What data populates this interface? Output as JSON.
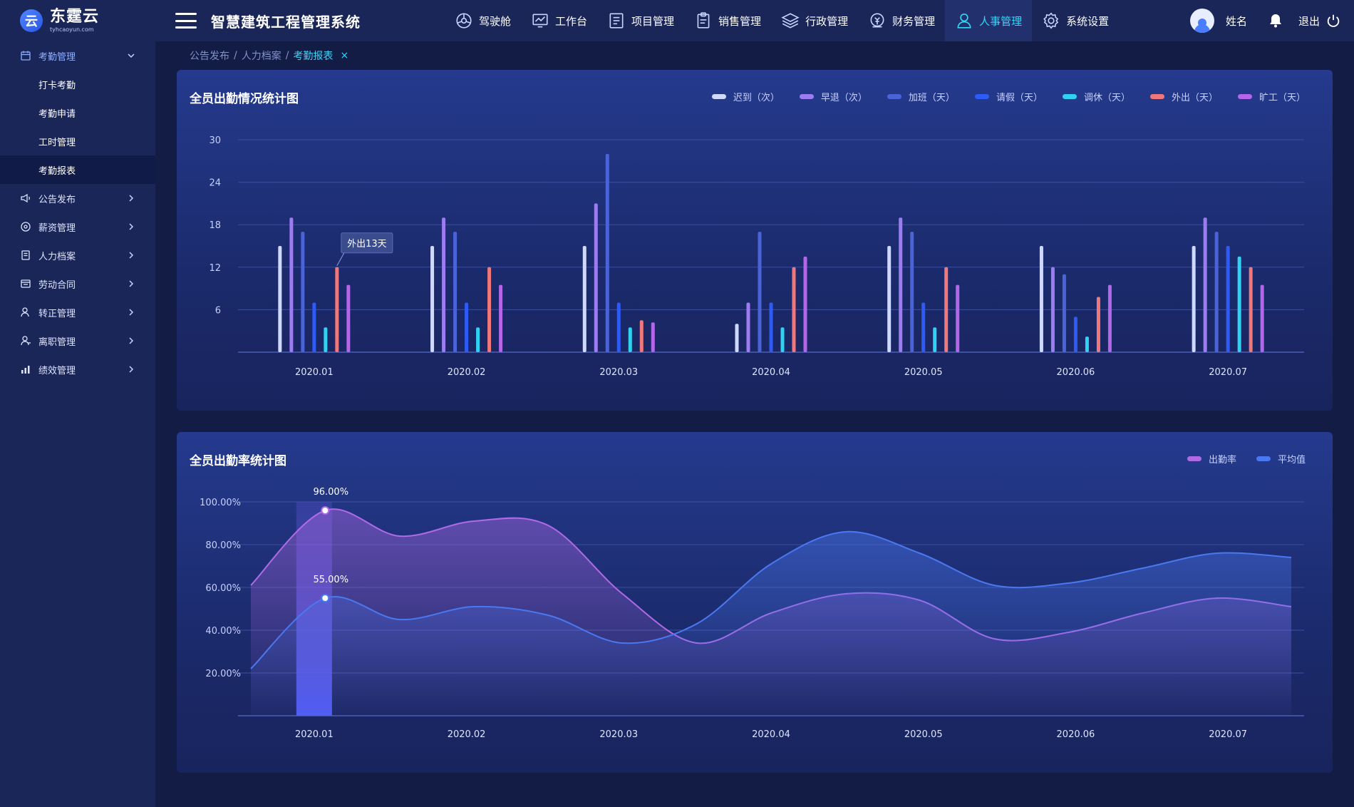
{
  "app": {
    "brand_name": "东霆云",
    "brand_sub": "tyhcaoyun.com",
    "title": "智慧建筑工程管理系统"
  },
  "topnav": [
    {
      "label": "驾驶舱",
      "icon": "dashboard-icon"
    },
    {
      "label": "工作台",
      "icon": "monitor-chart-icon"
    },
    {
      "label": "项目管理",
      "icon": "project-list-icon"
    },
    {
      "label": "销售管理",
      "icon": "clipboard-icon"
    },
    {
      "label": "行政管理",
      "icon": "layers-icon"
    },
    {
      "label": "财务管理",
      "icon": "money-icon"
    },
    {
      "label": "人事管理",
      "icon": "person-icon",
      "active": true
    },
    {
      "label": "系统设置",
      "icon": "gear-icon"
    }
  ],
  "user": {
    "name": "姓名",
    "logout_label": "退出"
  },
  "sidebar": {
    "group": {
      "label": "考勤管理",
      "icon": "calendar-icon"
    },
    "sub_items": [
      "打卡考勤",
      "考勤申请",
      "工时管理",
      "考勤报表"
    ],
    "active_sub": 3,
    "items": [
      {
        "label": "公告发布",
        "icon": "megaphone-icon"
      },
      {
        "label": "薪资管理",
        "icon": "money-circle-icon"
      },
      {
        "label": "人力档案",
        "icon": "archive-icon"
      },
      {
        "label": "劳动合同",
        "icon": "contract-icon"
      },
      {
        "label": "转正管理",
        "icon": "user-check-icon"
      },
      {
        "label": "离职管理",
        "icon": "user-leave-icon"
      },
      {
        "label": "绩效管理",
        "icon": "bar-chart-icon"
      }
    ]
  },
  "breadcrumb": {
    "items": [
      "公告发布",
      "人力档案"
    ],
    "current": "考勤报表",
    "close": "×"
  },
  "chart_data": [
    {
      "type": "bar",
      "title": "全员出勤情况统计图",
      "categories": [
        "2020.01",
        "2020.02",
        "2020.03",
        "2020.04",
        "2020.05",
        "2020.06",
        "2020.07"
      ],
      "ylim": [
        0,
        30
      ],
      "yticks": [
        6,
        12,
        18,
        24,
        30
      ],
      "grid": true,
      "legend_position": "top-right",
      "series": [
        {
          "name": "迟到（次）",
          "color": "#cfd9ff",
          "values": [
            15,
            15,
            15,
            4,
            15,
            15,
            15
          ]
        },
        {
          "name": "早退（次）",
          "color": "#9d7cf2",
          "values": [
            19,
            19,
            21,
            7,
            19,
            12,
            19
          ]
        },
        {
          "name": "加班（天）",
          "color": "#4a63d9",
          "values": [
            17,
            17,
            28,
            17,
            17,
            11,
            17
          ]
        },
        {
          "name": "请假（天）",
          "color": "#2e5bf5",
          "values": [
            7,
            7,
            7,
            7,
            7,
            5,
            15
          ]
        },
        {
          "name": "调休（天）",
          "color": "#2fd2f0",
          "values": [
            3.5,
            3.5,
            3.5,
            3.5,
            3.5,
            2.2,
            13.5
          ]
        },
        {
          "name": "外出（天）",
          "color": "#f0787a",
          "values": [
            12,
            12,
            4.5,
            12,
            12,
            7.8,
            12
          ]
        },
        {
          "name": "旷工（天）",
          "color": "#b366e8",
          "values": [
            9.5,
            9.5,
            4.2,
            13.5,
            9.5,
            9.5,
            9.5
          ]
        }
      ],
      "tooltip": {
        "category": "2020.01",
        "series": "外出（天）",
        "text": "外出13天"
      }
    },
    {
      "type": "area",
      "title": "全员出勤率统计图",
      "categories": [
        "2020.01",
        "2020.02",
        "2020.03",
        "2020.04",
        "2020.05",
        "2020.06",
        "2020.07"
      ],
      "ylim": [
        0,
        100
      ],
      "yticks": [
        "20.00%",
        "40.00%",
        "60.00%",
        "80.00%",
        "100.00%"
      ],
      "grid": true,
      "legend_position": "top-right",
      "x": [
        0.0,
        0.5,
        1.0,
        1.5,
        2.0,
        2.5,
        3.0,
        3.5,
        4.0,
        4.5,
        5.0,
        5.5,
        6.0,
        6.5,
        7.0
      ],
      "series": [
        {
          "name": "出勤率",
          "color": "#b06ae6",
          "values": [
            61,
            96,
            84,
            91,
            89,
            57,
            34,
            48,
            57,
            54,
            36,
            39,
            48,
            55,
            51
          ]
        },
        {
          "name": "平均值",
          "color": "#4a78f0",
          "values": [
            22,
            55,
            45,
            51,
            47,
            34,
            43,
            71,
            86,
            76,
            61,
            62,
            69,
            76,
            74
          ]
        }
      ],
      "highlight": {
        "category": "2020.01",
        "labels": [
          "96.00%",
          "55.00%"
        ]
      }
    }
  ]
}
